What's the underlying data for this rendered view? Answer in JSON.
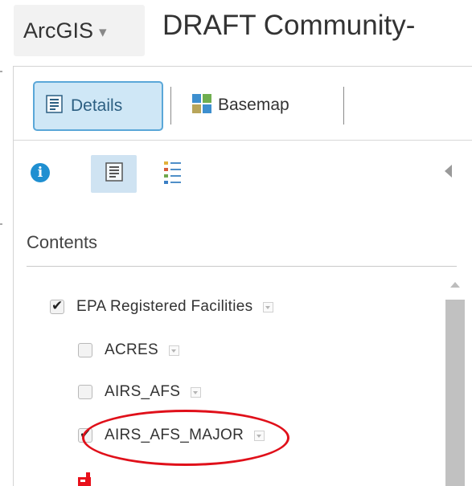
{
  "header": {
    "app_name": "ArcGIS",
    "app_caret": "▾",
    "map_title": "DRAFT Community-"
  },
  "toolbar": {
    "details_label": "Details",
    "basemap_label": "Basemap",
    "active_tab": "Details"
  },
  "panel": {
    "collapse_icon": "triangle-left-icon"
  },
  "contents": {
    "heading": "Contents",
    "layers": [
      {
        "label": "EPA Registered Facilities",
        "checked": true,
        "level": 0
      },
      {
        "label": "ACRES",
        "checked": false,
        "level": 1
      },
      {
        "label": "AIRS_AFS",
        "checked": false,
        "level": 1
      },
      {
        "label": "AIRS_AFS_MAJOR",
        "checked": true,
        "level": 1
      }
    ]
  },
  "annotation": {
    "circled_layer": "AIRS_AFS_MAJOR",
    "color": "#e0101a"
  },
  "colors": {
    "accent": "#1f8fd1",
    "active_tab_bg": "#cfe7f6",
    "active_tab_border": "#5aa7d8",
    "symbol_red": "#e8111c"
  }
}
